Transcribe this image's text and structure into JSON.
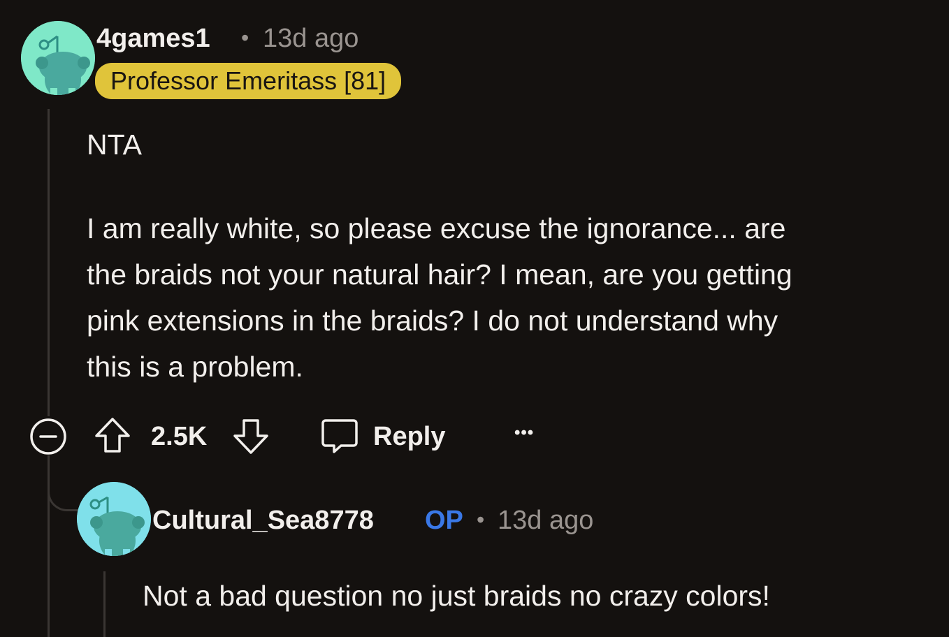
{
  "comment": {
    "username": "4games1",
    "separator": "•",
    "timestamp": "13d ago",
    "flair": "Professor Emeritass [81]",
    "body": {
      "paragraph1": "NTA",
      "paragraph2_line1": "I am really white, so please excuse the ignorance... are",
      "paragraph2_line2": "the braids not your natural hair? I mean, are you getting",
      "paragraph2_line3": "pink extensions in the braids? I do not understand why",
      "paragraph2_line4": "this is a problem."
    },
    "actions": {
      "collapse_icon": "collapse-icon",
      "upvote_icon": "upvote-arrow-icon",
      "score": "2.5K",
      "downvote_icon": "downvote-arrow-icon",
      "reply_icon": "speech-bubble-icon",
      "reply_label": "Reply",
      "more_label": "•••"
    },
    "avatar_color": "#7fe8c8"
  },
  "reply": {
    "username": "Cultural_Sea8778",
    "op_badge": "OP",
    "separator": "•",
    "timestamp": "13d ago",
    "body": "Not a bad question no just braids no crazy colors!",
    "avatar_color": "#7fe0ea"
  },
  "colors": {
    "background": "#14110f",
    "flair_bg": "#e0c43a",
    "op_blue": "#3a78e6",
    "thread_line": "#3a3633"
  }
}
